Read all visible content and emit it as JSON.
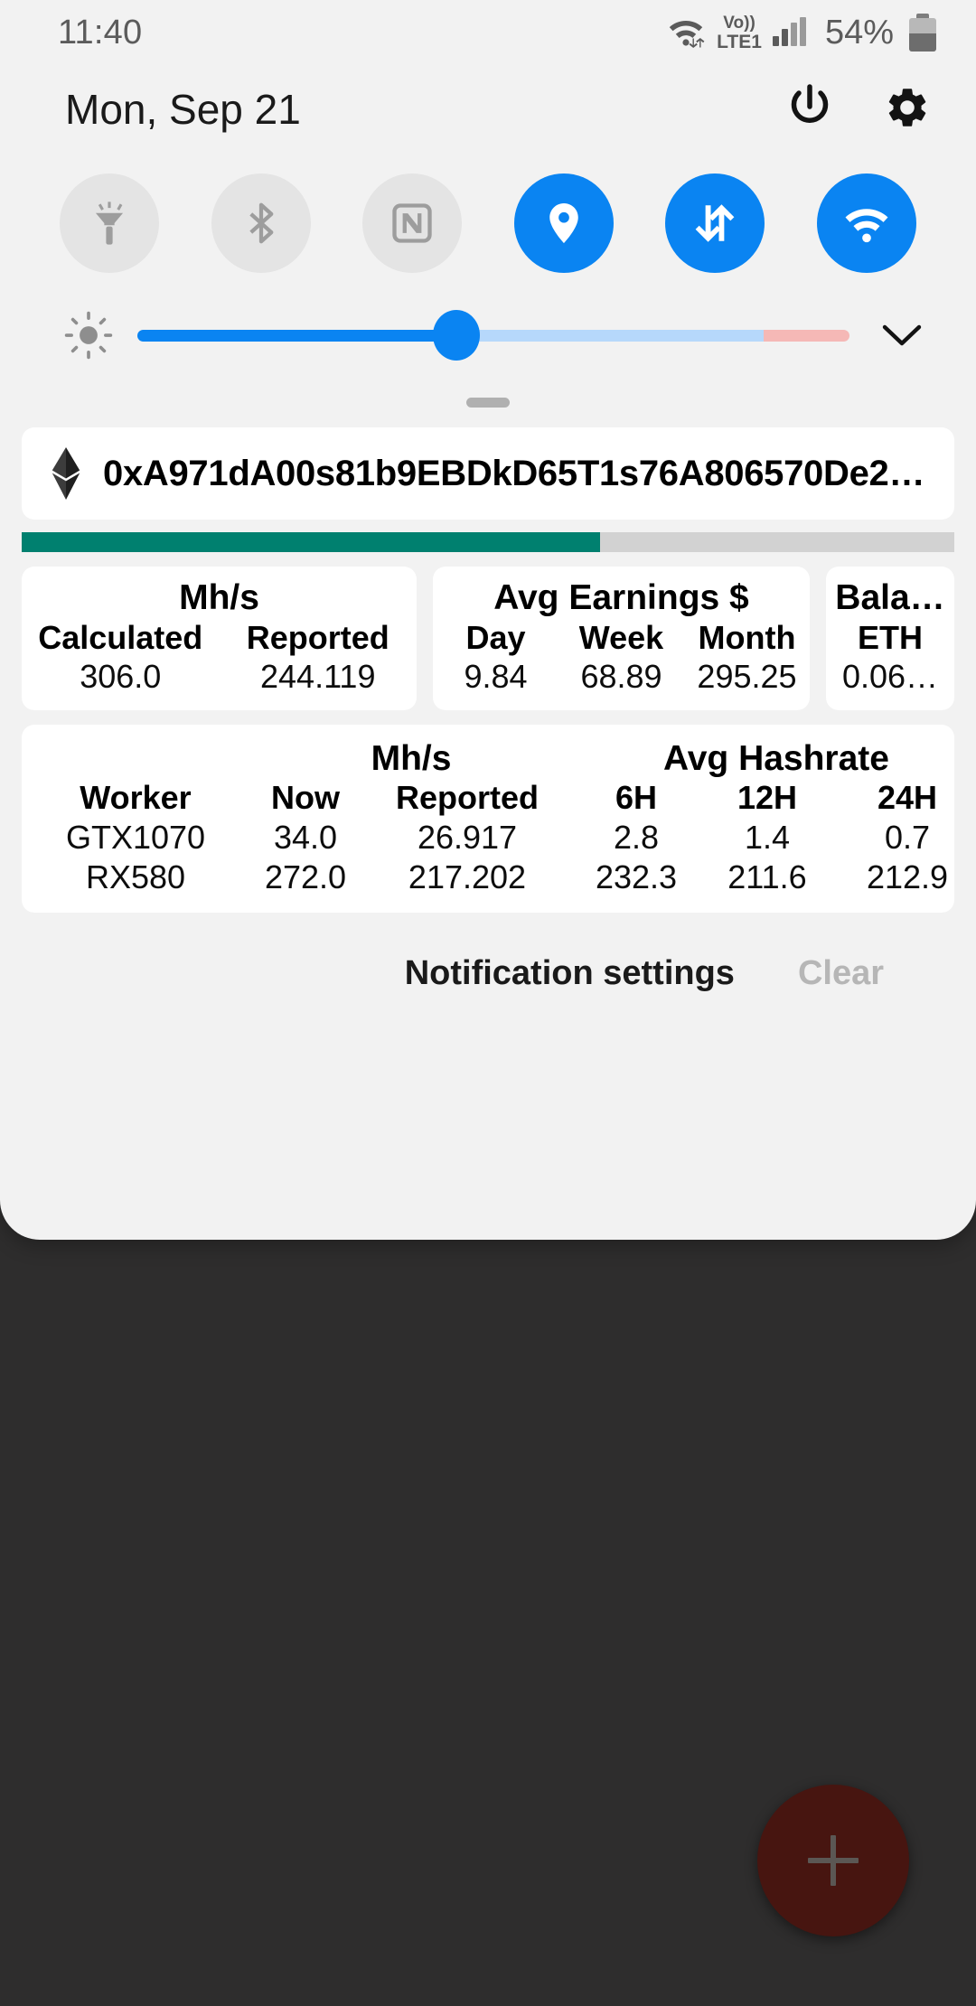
{
  "status_bar": {
    "clock": "11:40",
    "battery_percent": "54%",
    "network_label_top": "Vo))",
    "network_label_bottom": "LTE1",
    "icons": [
      "wifi-data-icon",
      "volte-icon",
      "signal-icon",
      "battery-icon"
    ]
  },
  "header": {
    "date": "Mon, Sep 21",
    "power_icon": "power-icon",
    "settings_icon": "gear-icon"
  },
  "quick_settings": {
    "toggles": [
      {
        "name": "flashlight",
        "label": "Flashlight",
        "active": false
      },
      {
        "name": "bluetooth",
        "label": "Bluetooth",
        "active": false
      },
      {
        "name": "nfc",
        "label": "NFC",
        "active": false
      },
      {
        "name": "location",
        "label": "Location",
        "active": true
      },
      {
        "name": "mobile-data",
        "label": "Mobile data",
        "active": true
      },
      {
        "name": "wifi",
        "label": "Wi-Fi",
        "active": true
      }
    ],
    "active_color": "#0a84f2",
    "inactive_color": "#e4e4e4"
  },
  "brightness": {
    "value_percent": 43,
    "light_end_percent": 88,
    "icon": "brightness-icon",
    "expand_icon": "chevron-down-icon"
  },
  "notification": {
    "app_icon": "ethereum-icon",
    "address": "0xA971dA00s81b9EBDkD65T1s76A806570De2…",
    "progress_percent": 62,
    "progress_color": "#00806f",
    "cards": [
      {
        "title": "Mh/s",
        "columns": [
          "Calculated",
          "Reported"
        ],
        "values": [
          "306.0",
          "244.119"
        ]
      },
      {
        "title": "Avg Earnings $",
        "columns": [
          "Day",
          "Week",
          "Month"
        ],
        "values": [
          "9.84",
          "68.89",
          "295.25"
        ]
      },
      {
        "title": "Bala…",
        "columns": [
          "ETH"
        ],
        "values": [
          "0.06…"
        ]
      }
    ],
    "workers_table": {
      "group_headers": [
        "Mh/s",
        "Avg Hashrate"
      ],
      "columns": [
        "Worker",
        "Now",
        "Reported",
        "6H",
        "12H",
        "24H"
      ],
      "rows": [
        {
          "worker": "GTX1070",
          "now": "34.0",
          "reported": "26.917",
          "h6": "2.8",
          "h12": "1.4",
          "h24": "0.7"
        },
        {
          "worker": "RX580",
          "now": "272.0",
          "reported": "217.202",
          "h6": "232.3",
          "h12": "211.6",
          "h24": "212.9"
        }
      ]
    }
  },
  "footer": {
    "notification_settings": "Notification settings",
    "clear": "Clear"
  },
  "background": {
    "fab_icon": "plus-icon",
    "fab_color": "#471510"
  }
}
